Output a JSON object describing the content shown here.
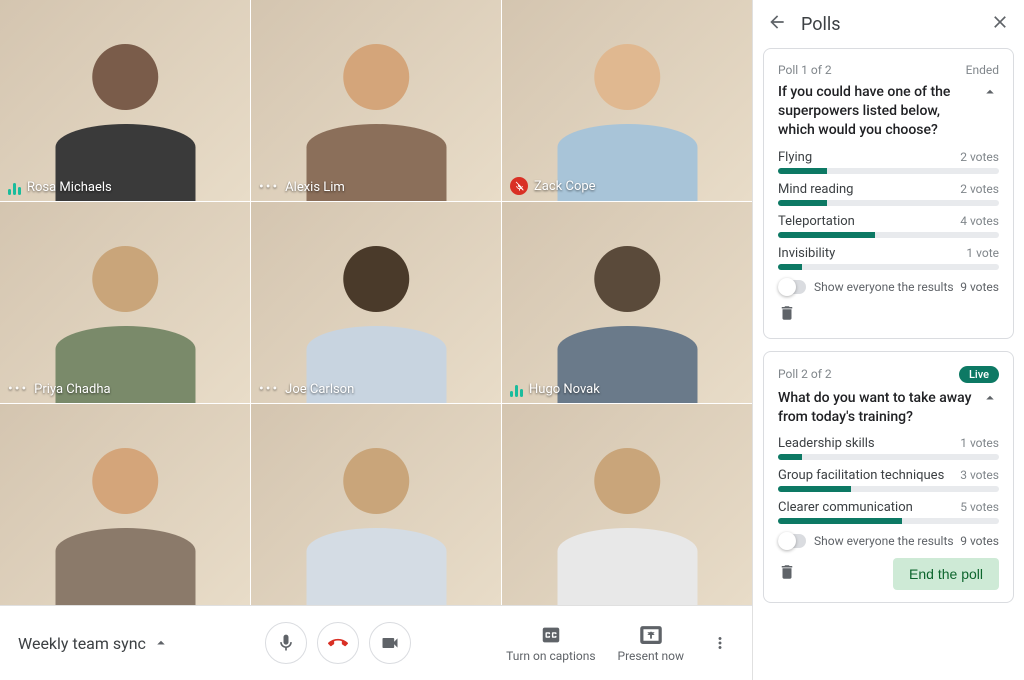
{
  "meeting_title": "Weekly team sync",
  "participants": [
    {
      "name": "Rosa Michaels",
      "speaking": true
    },
    {
      "name": "Alexis Lim",
      "speaking": false
    },
    {
      "name": "Zack Cope",
      "muted": true
    },
    {
      "name": "Priya Chadha",
      "speaking": false
    },
    {
      "name": "Joe Carlson",
      "speaking": false
    },
    {
      "name": "Hugo Novak",
      "speaking": true
    },
    {
      "name": ""
    },
    {
      "name": ""
    },
    {
      "name": ""
    }
  ],
  "bottom": {
    "captions": "Turn on captions",
    "present": "Present now"
  },
  "panel": {
    "title": "Polls",
    "polls": [
      {
        "meta": "Poll 1 of 2",
        "status": "Ended",
        "live": false,
        "question": "If you could have one of the superpowers listed below, which would you choose?",
        "options": [
          {
            "label": "Flying",
            "votes_label": "2 votes",
            "pct": 22
          },
          {
            "label": "Mind reading",
            "votes_label": "2 votes",
            "pct": 22
          },
          {
            "label": "Teleportation",
            "votes_label": "4 votes",
            "pct": 44
          },
          {
            "label": "Invisibility",
            "votes_label": "1 vote",
            "pct": 11
          }
        ],
        "show_results": "Show everyone the results",
        "total_votes": "9  votes"
      },
      {
        "meta": "Poll 2 of 2",
        "status": "Live",
        "live": true,
        "question": "What do you want to take away from today's training?",
        "options": [
          {
            "label": "Leadership skills",
            "votes_label": "1 votes",
            "pct": 11
          },
          {
            "label": "Group facilitation techniques",
            "votes_label": "3 votes",
            "pct": 33
          },
          {
            "label": "Clearer communication",
            "votes_label": "5 votes",
            "pct": 56
          }
        ],
        "show_results": "Show everyone the results",
        "total_votes": "9  votes",
        "end_label": "End the poll"
      }
    ]
  }
}
